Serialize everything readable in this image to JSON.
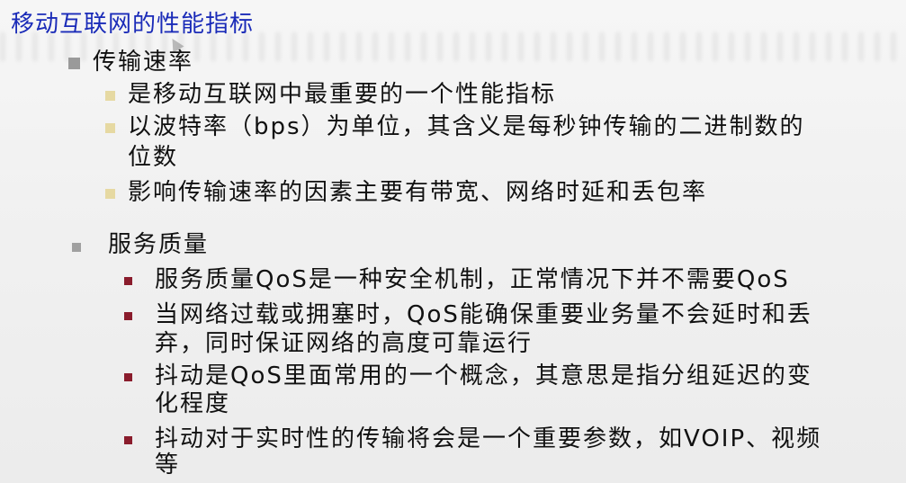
{
  "slide": {
    "title": "移动互联网的性能指标",
    "sections": [
      {
        "heading": "传输速率",
        "items": [
          "是移动互联网中最重要的一个性能指标",
          "以波特率（bps）为单位，其含义是每秒钟传输的二进制数的",
          "位数",
          "影响传输速率的因素主要有带宽、网络时延和丢包率"
        ]
      },
      {
        "heading": "服务质量",
        "items": [
          "服务质量QoS是一种安全机制，正常情况下并不需要QoS",
          "当网络过载或拥塞时，QoS能确保重要业务量不会延时和丢",
          "弃，同时保证网络的高度可靠运行",
          "抖动是QoS里面常用的一个概念，其意思是指分组延迟的变",
          "化程度",
          "抖动对于实时性的传输将会是一个重要参数，如VOIP、视频",
          "等"
        ]
      }
    ]
  }
}
